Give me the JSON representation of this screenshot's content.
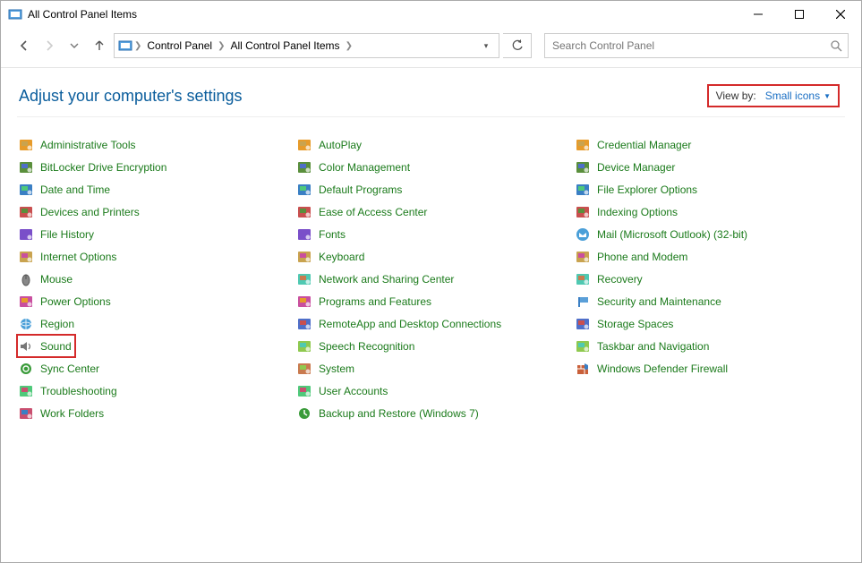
{
  "window": {
    "title": "All Control Panel Items"
  },
  "breadcrumb": {
    "seg1": "Control Panel",
    "seg2": "All Control Panel Items"
  },
  "search": {
    "placeholder": "Search Control Panel"
  },
  "header": {
    "title": "Adjust your computer's settings"
  },
  "viewby": {
    "label": "View by:",
    "value": "Small icons"
  },
  "items": [
    {
      "label": "Administrative Tools",
      "icon": "admin-tools-icon",
      "highlight": false
    },
    {
      "label": "BitLocker Drive Encryption",
      "icon": "bitlocker-icon",
      "highlight": false
    },
    {
      "label": "Date and Time",
      "icon": "datetime-icon",
      "highlight": false
    },
    {
      "label": "Devices and Printers",
      "icon": "devices-printers-icon",
      "highlight": false
    },
    {
      "label": "File History",
      "icon": "file-history-icon",
      "highlight": false
    },
    {
      "label": "Internet Options",
      "icon": "internet-options-icon",
      "highlight": false
    },
    {
      "label": "Mouse",
      "icon": "mouse-icon",
      "highlight": false
    },
    {
      "label": "Power Options",
      "icon": "power-options-icon",
      "highlight": false
    },
    {
      "label": "Region",
      "icon": "region-icon",
      "highlight": false
    },
    {
      "label": "Sound",
      "icon": "sound-icon",
      "highlight": true
    },
    {
      "label": "Sync Center",
      "icon": "sync-center-icon",
      "highlight": false
    },
    {
      "label": "Troubleshooting",
      "icon": "troubleshooting-icon",
      "highlight": false
    },
    {
      "label": "Work Folders",
      "icon": "work-folders-icon",
      "highlight": false
    },
    {
      "label": "AutoPlay",
      "icon": "autoplay-icon",
      "highlight": false
    },
    {
      "label": "Color Management",
      "icon": "color-management-icon",
      "highlight": false
    },
    {
      "label": "Default Programs",
      "icon": "default-programs-icon",
      "highlight": false
    },
    {
      "label": "Ease of Access Center",
      "icon": "ease-of-access-icon",
      "highlight": false
    },
    {
      "label": "Fonts",
      "icon": "fonts-icon",
      "highlight": false
    },
    {
      "label": "Keyboard",
      "icon": "keyboard-icon",
      "highlight": false
    },
    {
      "label": "Network and Sharing Center",
      "icon": "network-sharing-icon",
      "highlight": false
    },
    {
      "label": "Programs and Features",
      "icon": "programs-features-icon",
      "highlight": false
    },
    {
      "label": "RemoteApp and Desktop Connections",
      "icon": "remoteapp-icon",
      "highlight": false
    },
    {
      "label": "Speech Recognition",
      "icon": "speech-recognition-icon",
      "highlight": false
    },
    {
      "label": "System",
      "icon": "system-icon",
      "highlight": false
    },
    {
      "label": "User Accounts",
      "icon": "user-accounts-icon",
      "highlight": false
    },
    {
      "label": "Backup and Restore (Windows 7)",
      "icon": "backup-restore-icon",
      "highlight": false
    },
    {
      "label": "Credential Manager",
      "icon": "credential-manager-icon",
      "highlight": false
    },
    {
      "label": "Device Manager",
      "icon": "device-manager-icon",
      "highlight": false
    },
    {
      "label": "File Explorer Options",
      "icon": "file-explorer-options-icon",
      "highlight": false
    },
    {
      "label": "Indexing Options",
      "icon": "indexing-options-icon",
      "highlight": false
    },
    {
      "label": "Mail (Microsoft Outlook) (32-bit)",
      "icon": "mail-icon",
      "highlight": false
    },
    {
      "label": "Phone and Modem",
      "icon": "phone-modem-icon",
      "highlight": false
    },
    {
      "label": "Recovery",
      "icon": "recovery-icon",
      "highlight": false
    },
    {
      "label": "Security and Maintenance",
      "icon": "security-maintenance-icon",
      "highlight": false
    },
    {
      "label": "Storage Spaces",
      "icon": "storage-spaces-icon",
      "highlight": false
    },
    {
      "label": "Taskbar and Navigation",
      "icon": "taskbar-navigation-icon",
      "highlight": false
    },
    {
      "label": "Windows Defender Firewall",
      "icon": "defender-firewall-icon",
      "highlight": false
    }
  ]
}
